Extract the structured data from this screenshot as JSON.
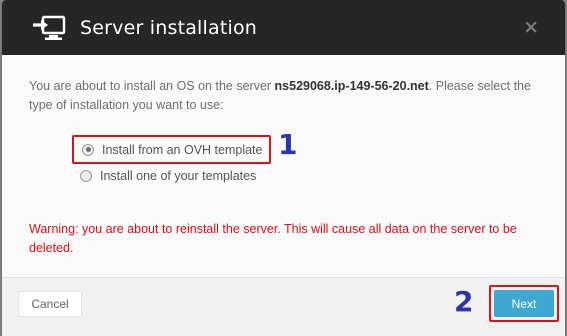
{
  "dialog": {
    "title": "Server installation",
    "close_glyph": "×",
    "icon": "server-install-icon"
  },
  "body": {
    "intro_before": "You are about to install an OS on the server ",
    "server_name": "ns529068.ip-149-56-20.net",
    "intro_after": ". Please select the type of installation you want to use:",
    "options": [
      {
        "label": "Install from an OVH template",
        "checked": true
      },
      {
        "label": "Install one of your templates",
        "checked": false
      }
    ],
    "warning": "Warning: you are about to reinstall the server. This will cause all data on the server to be deleted."
  },
  "annotations": {
    "callout_1": "1",
    "callout_2": "2",
    "callout_color": "#2b35a8",
    "highlight_color": "#d2161e"
  },
  "footer": {
    "cancel_label": "Cancel",
    "next_label": "Next"
  },
  "colors": {
    "header_bg": "#262626",
    "primary_button": "#3fa8d2",
    "warning_text": "#d0121a"
  }
}
